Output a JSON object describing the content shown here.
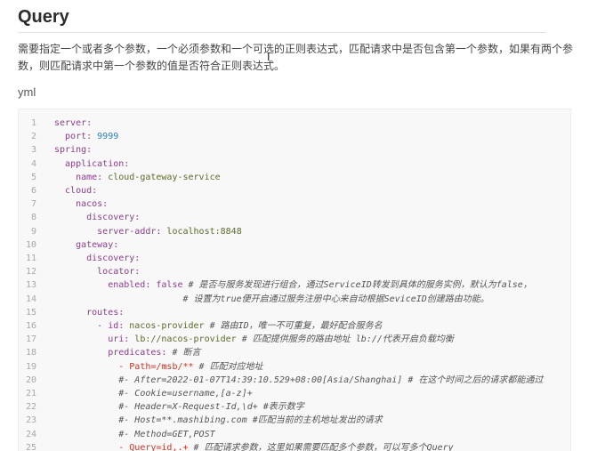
{
  "heading": "Query",
  "description": "需要指定一个或者多个参数，一个必须参数和一个可选的正则表达式，匹配请求中是否包含第一个参数，如果有两个参数，则匹配请求中第一个参数的值是否符合正则表达式。",
  "code_language": "yml",
  "code_lines": [
    {
      "n": "1",
      "indent": 0,
      "key": "server:",
      "val": "",
      "cmt": ""
    },
    {
      "n": "2",
      "indent": 2,
      "key": "port:",
      "val": " 9999",
      "cmt": "",
      "valclass": "num"
    },
    {
      "n": "3",
      "indent": 0,
      "key": "spring:",
      "val": "",
      "cmt": ""
    },
    {
      "n": "4",
      "indent": 2,
      "key": "application:",
      "val": "",
      "cmt": ""
    },
    {
      "n": "5",
      "indent": 4,
      "key": "name:",
      "val": " cloud-gateway-service",
      "cmt": ""
    },
    {
      "n": "6",
      "indent": 2,
      "key": "cloud:",
      "val": "",
      "cmt": ""
    },
    {
      "n": "7",
      "indent": 4,
      "key": "nacos:",
      "val": "",
      "cmt": ""
    },
    {
      "n": "8",
      "indent": 6,
      "key": "discovery:",
      "val": "",
      "cmt": ""
    },
    {
      "n": "9",
      "indent": 8,
      "key": "server-addr:",
      "val": " localhost:8848",
      "cmt": ""
    },
    {
      "n": "10",
      "indent": 4,
      "key": "gateway:",
      "val": "",
      "cmt": ""
    },
    {
      "n": "11",
      "indent": 6,
      "key": "discovery:",
      "val": "",
      "cmt": ""
    },
    {
      "n": "12",
      "indent": 8,
      "key": "locator:",
      "val": "",
      "cmt": ""
    },
    {
      "n": "13",
      "indent": 10,
      "key": "enabled:",
      "val": " false",
      "cmt": " # 是否与服务发现进行组合，通过ServiceID转发到具体的服务实例，默认为false，",
      "valclass": "bool"
    },
    {
      "n": "14",
      "indent": 0,
      "key": "",
      "val": "",
      "cmt": "                        # 设置为true便开启通过服务注册中心来自动根据SeviceID创建路由功能。"
    },
    {
      "n": "15",
      "indent": 6,
      "key": "routes:",
      "val": "",
      "cmt": ""
    },
    {
      "n": "16",
      "indent": 8,
      "key": "- id:",
      "val": " nacos-provider",
      "cmt": " # 路由ID，唯一不可重复，最好配合服务名"
    },
    {
      "n": "17",
      "indent": 10,
      "key": "uri:",
      "val": " lb://nacos-provider",
      "cmt": " # 匹配提供服务的路由地址 lb://代表开启负载均衡"
    },
    {
      "n": "18",
      "indent": 10,
      "key": "predicates:",
      "val": "",
      "cmt": " # 断言"
    },
    {
      "n": "19",
      "indent": 12,
      "key": "",
      "val": "- Path=/msb/**",
      "cmt": " # 匹配对应地址",
      "valclass": "red"
    },
    {
      "n": "20",
      "indent": 12,
      "key": "",
      "val": "",
      "cmt": "#- After=2022-01-07T14:39:10.529+08:00[Asia/Shanghai] # 在这个时间之后的请求都能通过"
    },
    {
      "n": "21",
      "indent": 12,
      "key": "",
      "val": "",
      "cmt": "#- Cookie=username,[a-z]+"
    },
    {
      "n": "22",
      "indent": 12,
      "key": "",
      "val": "",
      "cmt": "#- Header=X-Request-Id,\\d+ #表示数字"
    },
    {
      "n": "23",
      "indent": 12,
      "key": "",
      "val": "",
      "cmt": "#- Host=**.mashibing.com #匹配当前的主机地址发出的请求"
    },
    {
      "n": "24",
      "indent": 12,
      "key": "",
      "val": "",
      "cmt": "#- Method=GET,POST"
    },
    {
      "n": "25",
      "indent": 12,
      "key": "",
      "val": "- Query=id,.+",
      "cmt": " # 匹配请求参数，这里如果需要匹配多个参数，可以写多个Query",
      "valclass": "red"
    }
  ],
  "cursor_glyph": "I"
}
